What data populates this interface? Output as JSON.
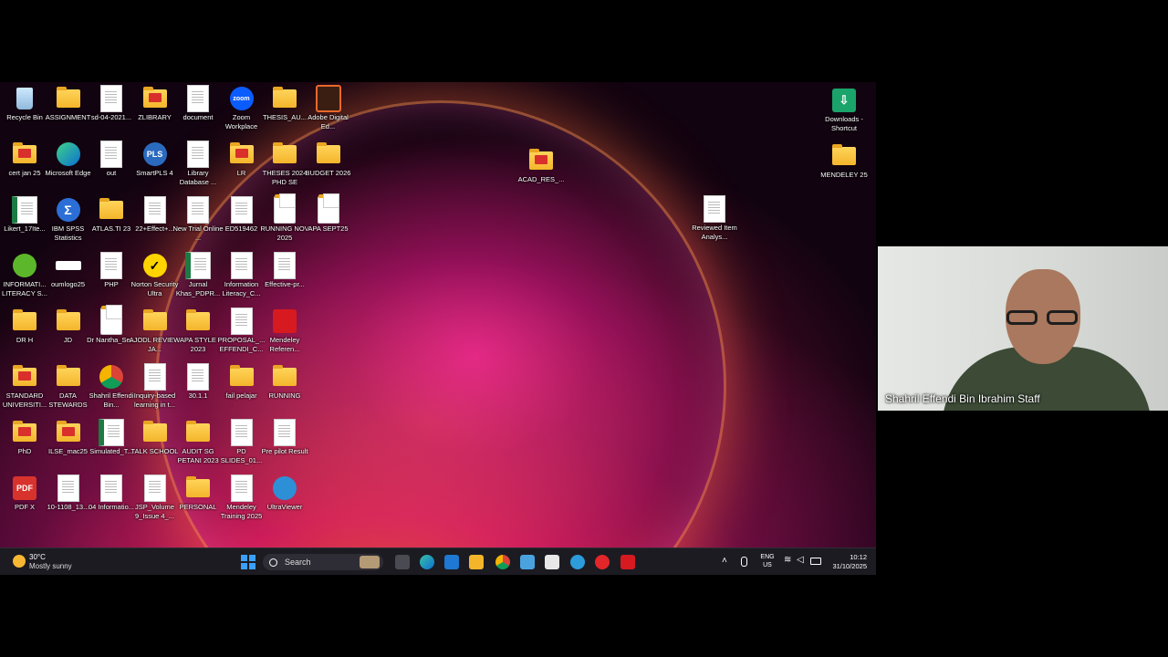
{
  "desktop": {
    "icons": [
      {
        "label": "Recycle Bin",
        "kind": "bin"
      },
      {
        "label": "ASSIGNMENT",
        "kind": "folder"
      },
      {
        "label": "sd-04-2021...",
        "kind": "doc"
      },
      {
        "label": "ZLIBRARY",
        "kind": "folder-red"
      },
      {
        "label": "document",
        "kind": "doc"
      },
      {
        "label": "Zoom Workplace",
        "kind": "zoom"
      },
      {
        "label": "THESIS_AU...",
        "kind": "folder"
      },
      {
        "label": "Adobe Digital Ed...",
        "kind": "adobe"
      },
      {
        "label": "cert jan 25",
        "kind": "folder-red"
      },
      {
        "label": "Microsoft Edge",
        "kind": "edge"
      },
      {
        "label": "out",
        "kind": "doc"
      },
      {
        "label": "SmartPLS 4",
        "kind": "pls"
      },
      {
        "label": "Library Database ...",
        "kind": "doc"
      },
      {
        "label": "LR",
        "kind": "folder-red"
      },
      {
        "label": "THESES 2024 PHD SE",
        "kind": "folder"
      },
      {
        "label": "BUDGET 2026",
        "kind": "folder"
      },
      {
        "label": "Likert_17Ite...",
        "kind": "excel"
      },
      {
        "label": "IBM SPSS Statistics",
        "kind": "spss"
      },
      {
        "label": "ATLAS.TI 23",
        "kind": "folder"
      },
      {
        "label": "22+Effect+...",
        "kind": "doc"
      },
      {
        "label": "New Trial Online ...",
        "kind": "doc"
      },
      {
        "label": "ED519462",
        "kind": "doc"
      },
      {
        "label": "RUNNING NOV 2025",
        "kind": "folder-doc"
      },
      {
        "label": "APA SEPT25",
        "kind": "folder-doc"
      },
      {
        "label": "INFORMATI... LITERACY S...",
        "kind": "green"
      },
      {
        "label": "oumlogo25",
        "kind": "oum"
      },
      {
        "label": "PHP",
        "kind": "doc"
      },
      {
        "label": "Norton Security Ultra",
        "kind": "norton"
      },
      {
        "label": "Jurnal Khas_PDPR...",
        "kind": "excel"
      },
      {
        "label": "Information Literacy_C...",
        "kind": "doc"
      },
      {
        "label": "Effective-pr...",
        "kind": "doc"
      },
      {
        "label": "DR H",
        "kind": "folder"
      },
      {
        "label": "JD",
        "kind": "folder"
      },
      {
        "label": "Dr Nantha_Se...",
        "kind": "folder-doc"
      },
      {
        "label": "AJODL REVIEW JA...",
        "kind": "folder"
      },
      {
        "label": "APA STYLE 2023",
        "kind": "folder"
      },
      {
        "label": "PROPOSAL_... EFFENDI_C...",
        "kind": "doc"
      },
      {
        "label": "Mendeley Referen...",
        "kind": "mendeley"
      },
      {
        "label": "STANDARD UNIVERSITI...",
        "kind": "folder-red"
      },
      {
        "label": "DATA STEWARDS",
        "kind": "folder"
      },
      {
        "label": "Shahril Effendi Bin...",
        "kind": "chrome"
      },
      {
        "label": "Inquiry-based learning in t...",
        "kind": "doc"
      },
      {
        "label": "30.1.1",
        "kind": "doc"
      },
      {
        "label": "fail pelajar",
        "kind": "folder"
      },
      {
        "label": "RUNNING",
        "kind": "folder"
      },
      {
        "label": "PhD",
        "kind": "folder-red"
      },
      {
        "label": "ILSE_mac25",
        "kind": "folder-red"
      },
      {
        "label": "Simulated_T...",
        "kind": "excel"
      },
      {
        "label": "TALK SCHOOL",
        "kind": "folder"
      },
      {
        "label": "AUDIT SG PETANI 2023",
        "kind": "folder"
      },
      {
        "label": "PD SLIDES_01...",
        "kind": "doc"
      },
      {
        "label": "Pre pilot Result",
        "kind": "doc"
      },
      {
        "label": "PDF X",
        "kind": "pdfx"
      },
      {
        "label": "10-1108_13...",
        "kind": "doc"
      },
      {
        "label": "04 Informatio...",
        "kind": "doc"
      },
      {
        "label": "JSP_Volume 9_Issue 4_...",
        "kind": "doc"
      },
      {
        "label": "PERSONAL",
        "kind": "folder"
      },
      {
        "label": "Mendeley Training 2025",
        "kind": "doc"
      },
      {
        "label": "UltraViewer",
        "kind": "ultraviewer"
      },
      {
        "label": "ACAD_RES_...",
        "kind": "folder-red"
      },
      {
        "label": "Reviewed Item Analys...",
        "kind": "doc"
      },
      {
        "label": "Downloads - Shortcut",
        "kind": "downloads"
      },
      {
        "label": "MENDELEY 25",
        "kind": "folder"
      }
    ]
  },
  "taskbar": {
    "weather_temp": "30°C",
    "weather_desc": "Mostly sunny",
    "search_placeholder": "Search",
    "language": "ENG",
    "region": "US",
    "time": "10:12",
    "date": "31/10/2025"
  },
  "video": {
    "participant_name": "Shahril Effendi Bin Ibrahim Staff"
  },
  "colors": {
    "taskbar_bg": "#1c1b22",
    "folder_yellow": "#f4b52b",
    "accent_blue": "#0078d4"
  }
}
